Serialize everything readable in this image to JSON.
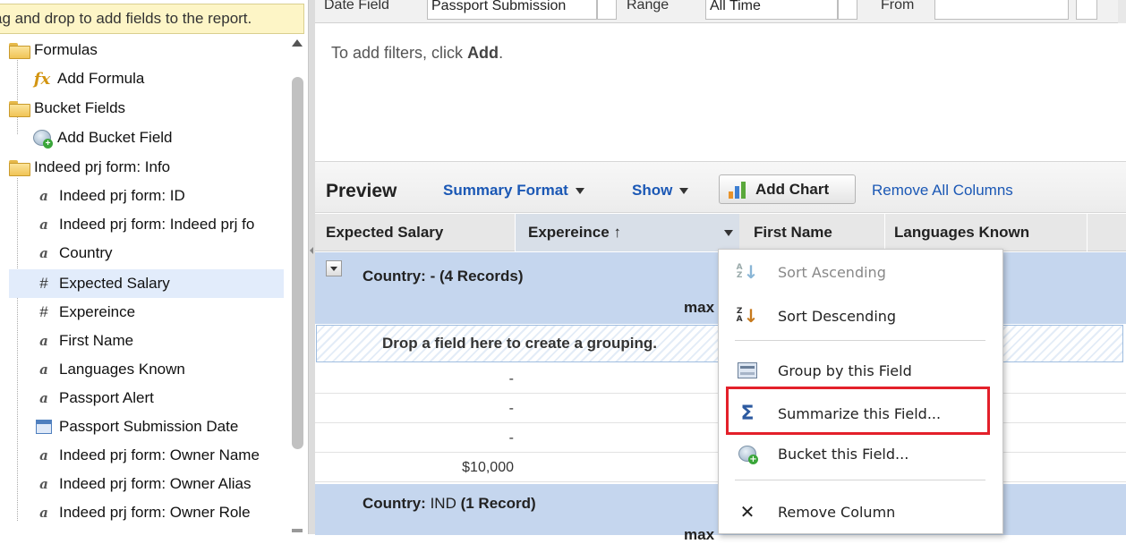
{
  "left_panel": {
    "hint": "ag and drop to add fields to the report.",
    "tree": [
      {
        "label": "Formulas",
        "icon": "folder-icon",
        "kind": "folder"
      },
      {
        "label": "Add Formula",
        "icon": "formula-icon",
        "kind": "child"
      },
      {
        "label": "Bucket Fields",
        "icon": "folder-icon",
        "kind": "folder"
      },
      {
        "label": "Add Bucket Field",
        "icon": "bucket-icon",
        "kind": "child"
      },
      {
        "label": "Indeed prj form: Info",
        "icon": "folder-icon",
        "kind": "folder"
      },
      {
        "label": "Indeed prj form: ID",
        "icon": "text-field-icon",
        "kind": "child"
      },
      {
        "label": "Indeed prj form: Indeed prj fo",
        "icon": "text-field-icon",
        "kind": "child"
      },
      {
        "label": "Country",
        "icon": "text-field-icon",
        "kind": "child"
      },
      {
        "label": "Expected Salary",
        "icon": "number-field-icon",
        "kind": "child",
        "selected": true
      },
      {
        "label": "Expereince",
        "icon": "number-field-icon",
        "kind": "child"
      },
      {
        "label": "First Name",
        "icon": "text-field-icon",
        "kind": "child"
      },
      {
        "label": "Languages Known",
        "icon": "text-field-icon",
        "kind": "child"
      },
      {
        "label": "Passport Alert",
        "icon": "text-field-icon",
        "kind": "child"
      },
      {
        "label": "Passport Submission Date",
        "icon": "date-field-icon",
        "kind": "child"
      },
      {
        "label": "Indeed prj form: Owner Name",
        "icon": "text-field-icon",
        "kind": "child"
      },
      {
        "label": "Indeed prj form: Owner Alias",
        "icon": "text-field-icon",
        "kind": "child"
      },
      {
        "label": "Indeed prj form: Owner Role",
        "icon": "text-field-icon",
        "kind": "child"
      }
    ]
  },
  "filter_bar": {
    "date_field_label": "Date Field",
    "date_field_value": "Passport Submission",
    "range_label": "Range",
    "range_value": "All Time",
    "from_label": "From"
  },
  "filters": {
    "hint_prefix": "To add filters, click ",
    "hint_action": "Add",
    "hint_suffix": "."
  },
  "preview": {
    "title": "Preview",
    "format_label": "Summary Format",
    "show_label": "Show",
    "add_chart_label": "Add Chart",
    "remove_columns_label": "Remove All Columns",
    "columns": [
      "Expected Salary",
      "Expereince ↑",
      "First Name",
      "Languages Known"
    ],
    "groups": [
      {
        "label": "Country:",
        "value": "-",
        "count": "(4 Records)",
        "summary": "max"
      },
      {
        "label": "Country:",
        "value": "IND",
        "count": "(1 Record)",
        "summary": "max"
      }
    ],
    "dropzone_text": "Drop a field here to create a grouping.",
    "rows": [
      "-",
      "-",
      "-",
      "$10,000"
    ]
  },
  "context_menu": {
    "items": [
      {
        "label": "Sort Ascending",
        "icon": "sort-ascending-icon",
        "disabled": true
      },
      {
        "label": "Sort Descending",
        "icon": "sort-descending-icon",
        "disabled": false
      },
      {
        "label": "Group by this Field",
        "icon": "group-icon",
        "disabled": false
      },
      {
        "label": "Summarize this Field...",
        "icon": "sigma-icon",
        "disabled": false,
        "highlighted": true
      },
      {
        "label": "Bucket this Field...",
        "icon": "bucket-icon",
        "disabled": false
      },
      {
        "label": "Remove Column",
        "icon": "remove-icon",
        "disabled": false
      }
    ]
  },
  "colors": {
    "link": "#1b58b5",
    "group_band": "#c5d6ee",
    "highlight_box": "#e3202a",
    "hint_bg": "#fdf5c6"
  }
}
